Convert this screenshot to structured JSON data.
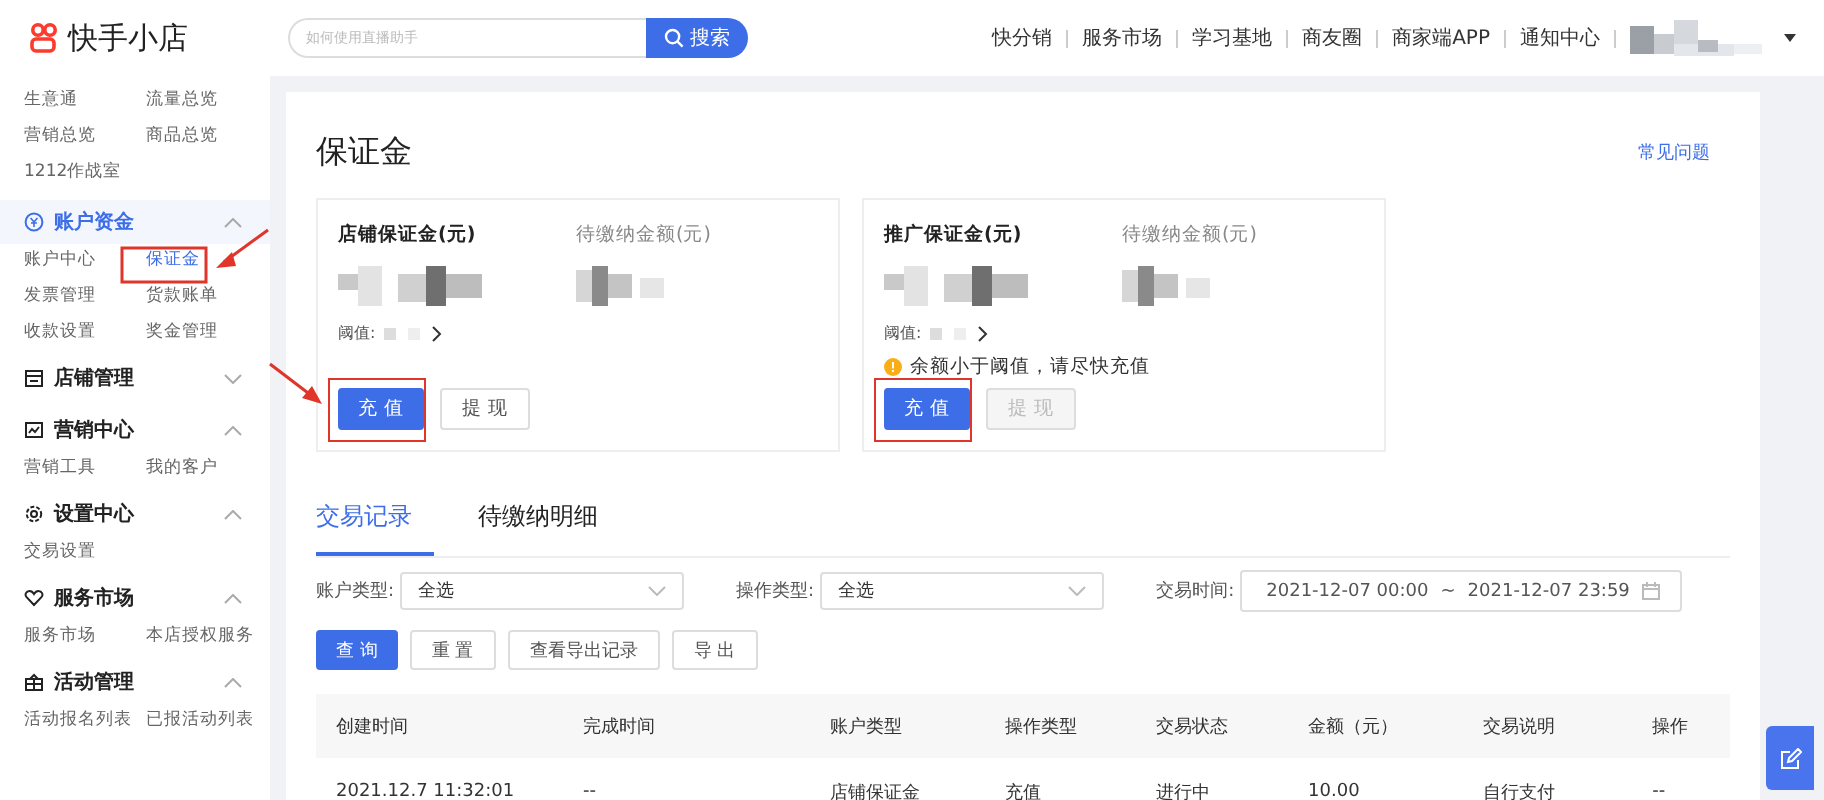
{
  "header": {
    "logo": "快手小店",
    "search": {
      "placeholder": "如何使用直播助手",
      "button": "搜索"
    },
    "nav": [
      "快分销",
      "服务市场",
      "学习基地",
      "商友圈",
      "商家端APP",
      "通知中心"
    ]
  },
  "sidebar": {
    "top_items": [
      "生意通",
      "流量总览",
      "营销总览",
      "商品总览",
      "1212作战室"
    ],
    "sections": [
      {
        "title": "账户资金",
        "expanded": true,
        "active": true,
        "items": [
          {
            "label": "账户中心",
            "selected": false
          },
          {
            "label": "保证金",
            "selected": true
          },
          {
            "label": "发票管理",
            "selected": false
          },
          {
            "label": "货款账单",
            "selected": false
          },
          {
            "label": "收款设置",
            "selected": false
          },
          {
            "label": "奖金管理",
            "selected": false
          }
        ]
      },
      {
        "title": "店铺管理",
        "expanded": false,
        "active": false
      },
      {
        "title": "营销中心",
        "expanded": true,
        "active": false,
        "items": [
          {
            "label": "营销工具",
            "selected": false
          },
          {
            "label": "我的客户",
            "selected": false
          }
        ]
      },
      {
        "title": "设置中心",
        "expanded": true,
        "active": false,
        "items": [
          {
            "label": "交易设置",
            "selected": false
          }
        ]
      },
      {
        "title": "服务市场",
        "expanded": true,
        "active": false,
        "items": [
          {
            "label": "服务市场",
            "selected": false
          },
          {
            "label": "本店授权服务",
            "selected": false
          }
        ]
      },
      {
        "title": "活动管理",
        "expanded": true,
        "active": false,
        "items": [
          {
            "label": "活动报名列表",
            "selected": false
          },
          {
            "label": "已报活动列表",
            "selected": false
          }
        ]
      }
    ]
  },
  "page": {
    "title": "保证金",
    "help_link": "常见问题"
  },
  "deposit_cards": [
    {
      "title": "店铺保证金(元)",
      "pending_label": "待缴纳金额(元)",
      "threshold_label": "阈值:",
      "buttons": [
        {
          "label": "充 值",
          "kind": "primary",
          "disabled": false
        },
        {
          "label": "提 现",
          "kind": "default",
          "disabled": false
        }
      ]
    },
    {
      "title": "推广保证金(元)",
      "pending_label": "待缴纳金额(元)",
      "threshold_label": "阈值:",
      "warning": "余额小于阈值，请尽快充值",
      "buttons": [
        {
          "label": "充 值",
          "kind": "primary",
          "disabled": false
        },
        {
          "label": "提 现",
          "kind": "default",
          "disabled": true
        }
      ]
    }
  ],
  "tabs": [
    {
      "label": "交易记录",
      "selected": true
    },
    {
      "label": "待缴纳明细",
      "selected": false
    }
  ],
  "filters": [
    {
      "label": "账户类型:",
      "value": "全选",
      "kind": "select"
    },
    {
      "label": "操作类型:",
      "value": "全选",
      "kind": "select"
    },
    {
      "label": "交易时间:",
      "start": "2021-12-07 00:00",
      "separator": "~",
      "end": "2021-12-07 23:59",
      "kind": "range"
    }
  ],
  "actions": [
    {
      "label": "查 询",
      "kind": "primary"
    },
    {
      "label": "重 置",
      "kind": "default"
    },
    {
      "label": "查看导出记录",
      "kind": "default"
    },
    {
      "label": "导 出",
      "kind": "default"
    }
  ],
  "table": {
    "columns": [
      "创建时间",
      "完成时间",
      "账户类型",
      "操作类型",
      "交易状态",
      "金额（元）",
      "交易说明",
      "操作"
    ],
    "rows": [
      [
        "2021.12.7 11:32:01",
        "--",
        "店铺保证金",
        "充值",
        "进行中",
        "10.00",
        "自行支付",
        "--"
      ]
    ]
  }
}
